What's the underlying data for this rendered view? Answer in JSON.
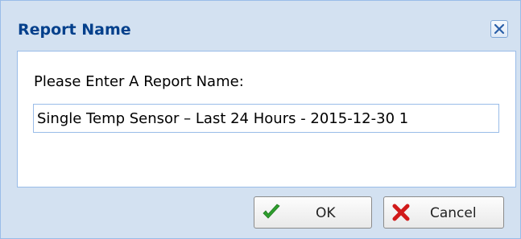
{
  "dialog": {
    "title": "Report Name",
    "prompt": "Please Enter A Report Name:",
    "input_value": "Single Temp Sensor – Last 24 Hours - 2015-12-30 1",
    "close_icon": "close-icon"
  },
  "buttons": {
    "ok_label": "OK",
    "ok_icon": "checkmark-icon",
    "cancel_label": "Cancel",
    "cancel_icon": "cross-icon"
  },
  "colors": {
    "title_text": "#04408c",
    "frame": "#d3e1f1",
    "border": "#99bce8",
    "ok_check": "#2e9e2e",
    "cancel_x": "#d11a1a"
  }
}
